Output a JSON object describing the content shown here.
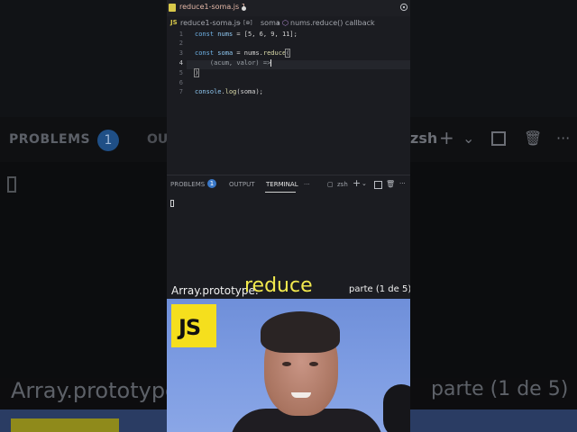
{
  "editor": {
    "tab": {
      "filename": "reduce1-soma.js",
      "problems": "1"
    },
    "breadcrumb": {
      "file": "reduce1-soma.js",
      "sep1": "›",
      "symbol_prefix": "[⊕]",
      "symbol": "soma",
      "sep2": "›",
      "callback": "nums.reduce() callback"
    },
    "lines": [
      {
        "n": "1",
        "kw": "const ",
        "var": "nums",
        "rest": " = [5, 6, 9, 11];"
      },
      {
        "n": "2"
      },
      {
        "n": "3",
        "kw": "const ",
        "var": "soma",
        "mid": " = nums.",
        "fn": "reduce",
        "tail": "("
      },
      {
        "n": "4",
        "indent": "    ",
        "args": "(acum, valor) =>"
      },
      {
        "n": "5",
        "close": ")"
      },
      {
        "n": "6"
      },
      {
        "n": "7",
        "obj": "console",
        "dot": ".",
        "fn": "log",
        "args": "(soma);"
      }
    ]
  },
  "panel": {
    "tabs": {
      "problems": "PROBLEMS",
      "problems_count": "1",
      "output": "OUTPUT",
      "terminal": "TERMINAL",
      "more": "···"
    },
    "shell": "zsh"
  },
  "caption": {
    "prefix": "Array.prototype.",
    "highlight": "reduce",
    "part": "parte (1 de 5)"
  },
  "logo": {
    "text": "JS",
    "color": "#f5df1d"
  },
  "background": {
    "problems": "PROBLEMS",
    "badge": "1",
    "ou": "OU",
    "zsh": "zsh",
    "caption_left": "Array.prototype",
    "caption_right": "parte (1 de 5)"
  }
}
